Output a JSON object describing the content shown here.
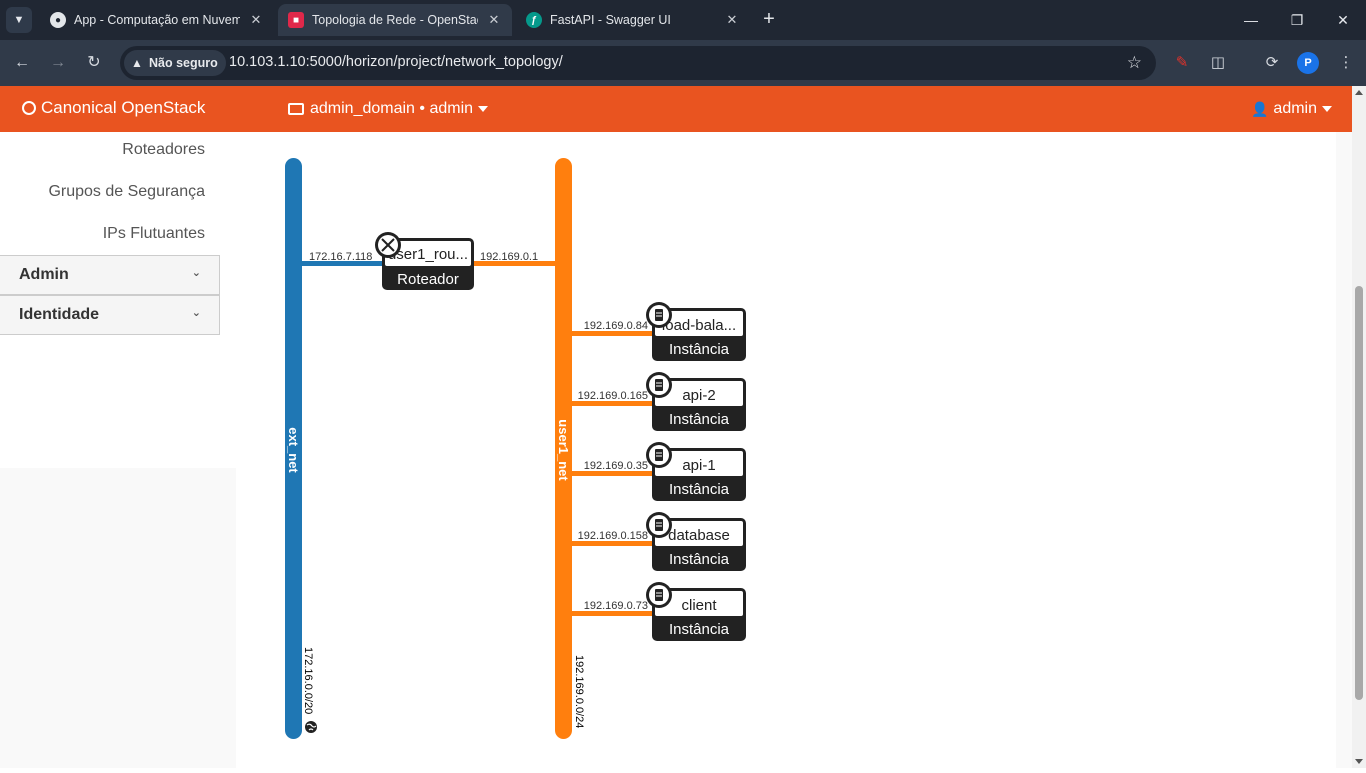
{
  "browser": {
    "tabs": [
      {
        "title": "App - Computação em Nuvem",
        "icon": "github-icon"
      },
      {
        "title": "Topologia de Rede - OpenStack",
        "icon": "openstack-icon"
      },
      {
        "title": "FastAPI - Swagger UI",
        "icon": "fastapi-icon"
      }
    ],
    "security_label": "Não seguro",
    "url_host": "10.103.1.10",
    "url_rest": ":5000/horizon/project/network_topology/",
    "profile_initial": "P"
  },
  "header": {
    "brand": "Canonical OpenStack",
    "project": "admin_domain • admin",
    "user": "admin",
    "accent": "#e95420"
  },
  "sidebar": {
    "links": [
      "Roteadores",
      "Grupos de Segurança",
      "IPs Flutuantes"
    ],
    "sections": [
      "Admin",
      "Identidade"
    ]
  },
  "topology": {
    "networks": [
      {
        "name": "ext_net",
        "cidr": "172.16.0.0/20",
        "color": "#1f77b4",
        "external": true
      },
      {
        "name": "user1_net",
        "cidr": "192.169.0.0/24",
        "color": "#ff7f0e",
        "external": false
      }
    ],
    "router": {
      "name": "user1_rou...",
      "type": "Roteador",
      "ip_left": "172.16.7.118",
      "ip_right": "192.169.0.1"
    },
    "instances": [
      {
        "name": "load-bala...",
        "type": "Instância",
        "ip": "192.169.0.84"
      },
      {
        "name": "api-2",
        "type": "Instância",
        "ip": "192.169.0.165"
      },
      {
        "name": "api-1",
        "type": "Instância",
        "ip": "192.169.0.35"
      },
      {
        "name": "database",
        "type": "Instância",
        "ip": "192.169.0.158"
      },
      {
        "name": "client",
        "type": "Instância",
        "ip": "192.169.0.73"
      }
    ]
  }
}
